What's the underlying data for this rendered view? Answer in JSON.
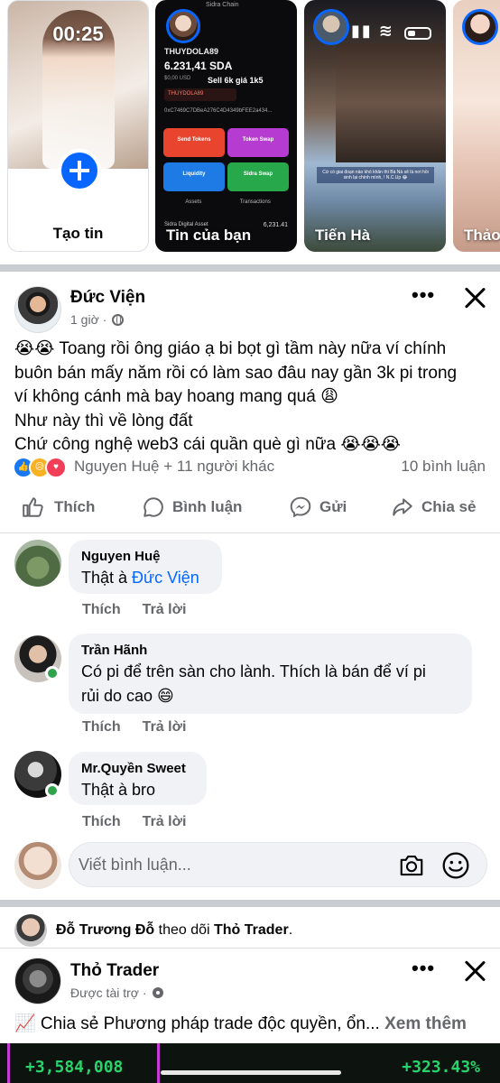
{
  "stories": {
    "create": {
      "time": "00:25",
      "label": "Tạo tin"
    },
    "wallet": {
      "label": "Tin của bạn",
      "header": "Sidra Chain",
      "user": "THUYDOLA89",
      "balance": "6.231,41 SDA",
      "usd": "$0,00 USD",
      "sell_note": "Sell 6k giá 1k5",
      "tag": "THUYDOLA89",
      "address": "0xC7469C7DBeA276C4D4349bFEE2a434...",
      "buttons": [
        "Send Tokens",
        "Token Swap",
        "Liquidity",
        "Sidra Swap"
      ],
      "tabs": [
        "Assets",
        "Transactions"
      ],
      "asset_name": "Sidra Digital Asset",
      "asset_value": "6,231.41"
    },
    "tien": {
      "label": "Tiến Hà",
      "caption": "Cứ có giai đoạn nào khó khăn thì Bà Nà sẽ là nơi hồi sinh lại chính mình, ! N.C.Up 😂"
    },
    "thao": {
      "label": "Thảo"
    }
  },
  "post": {
    "author": "Đức Viện",
    "time": "1 giờ",
    "lines": [
      "😭😭 Toang rồi ông giáo ạ bi bọt gì tầm này nữa ví chính",
      "buôn bán mấy năm rồi có làm sao đâu nay gần 3k pi trong",
      "ví không cánh mà bay hoang mang quá 😩",
      "Như này thì về lòng đất",
      "Chứ công nghệ web3 cái quần què gì nữa 😭😭😭"
    ],
    "reactions_text": "Nguyen Huệ + 11 người khác",
    "comments_count": "10 bình luận",
    "actions": {
      "like": "Thích",
      "comment": "Bình luận",
      "send": "Gửi",
      "share": "Chia sẻ"
    }
  },
  "comments": [
    {
      "name": "Nguyen Huệ",
      "text": "Thật à ",
      "mention": "Đức Viện",
      "like": "Thích",
      "reply": "Trả lời"
    },
    {
      "name": "Trần Hãnh",
      "line1": "Có pi để trên sàn cho lành. Thích là bán để ví pi",
      "line2": "rủi do cao 😄",
      "like": "Thích",
      "reply": "Trả lời"
    },
    {
      "name": "Mr.Quyền Sweet",
      "text": "Thật à bro",
      "like": "Thích",
      "reply": "Trả lời"
    }
  ],
  "write_comment": {
    "placeholder": "Viết bình luận..."
  },
  "next_post": {
    "follower": "Đỗ Trương Đỗ",
    "follow_verb": " theo dõi ",
    "followed": "Thỏ Trader",
    "follow_end": ".",
    "author": "Thỏ Trader",
    "sponsored": "Được tài trợ",
    "text": "📈 Chia sẻ Phương pháp trade độc quyền, ổn... ",
    "see_more": "Xem thêm"
  },
  "ticker": {
    "left": "+3,584,008",
    "right": "+323.43%"
  },
  "colors": {
    "accent": "#0866ff",
    "online": "#31a24c",
    "ticker_green": "#29d36b"
  }
}
